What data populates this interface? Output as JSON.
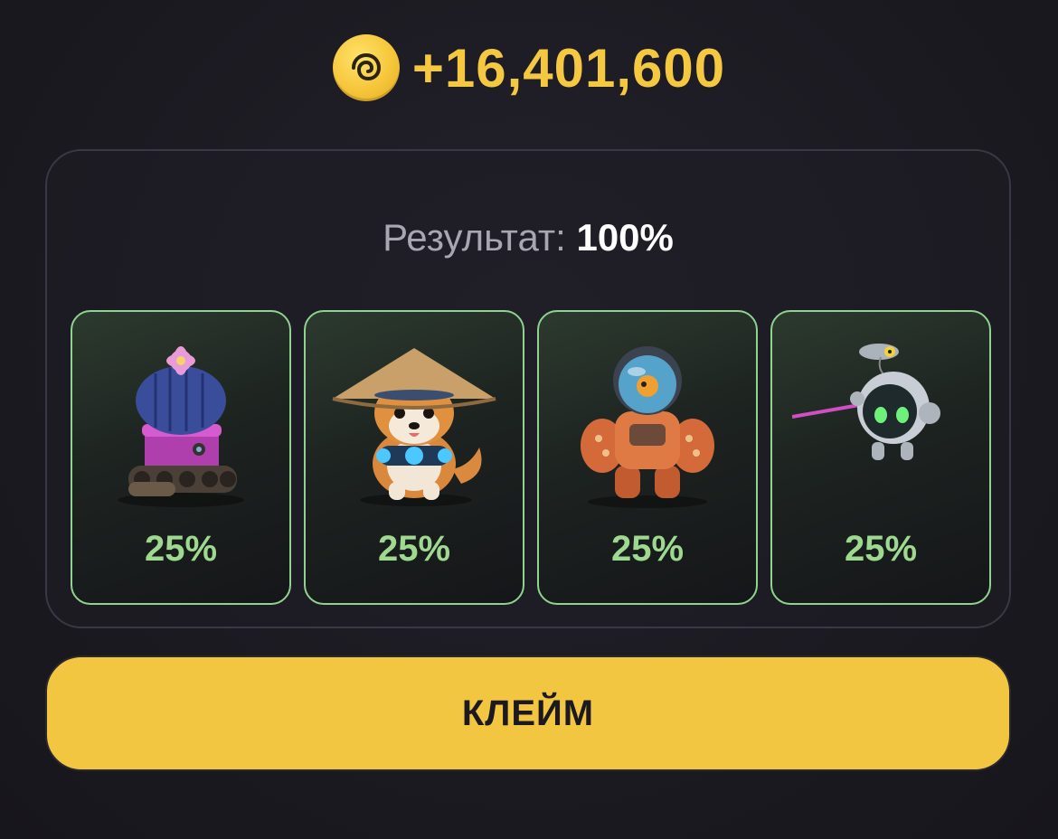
{
  "reward": {
    "icon": "coin-icon",
    "amount": "+16,401,600",
    "color": "#f5c842"
  },
  "result": {
    "label": "Результат:",
    "value": "100%"
  },
  "cards": [
    {
      "name": "cactus-tank-character",
      "icon": "cactus-robot-icon",
      "percent": "25%"
    },
    {
      "name": "shiba-dog-character",
      "icon": "dog-with-hat-icon",
      "percent": "25%"
    },
    {
      "name": "mech-suit-character",
      "icon": "mech-robot-icon",
      "percent": "25%"
    },
    {
      "name": "drone-robot-character",
      "icon": "drone-robot-icon",
      "percent": "25%"
    }
  ],
  "accent_green": "#8fd38f",
  "claim_button": {
    "label": "КЛЕЙМ",
    "color": "#f3c642"
  }
}
